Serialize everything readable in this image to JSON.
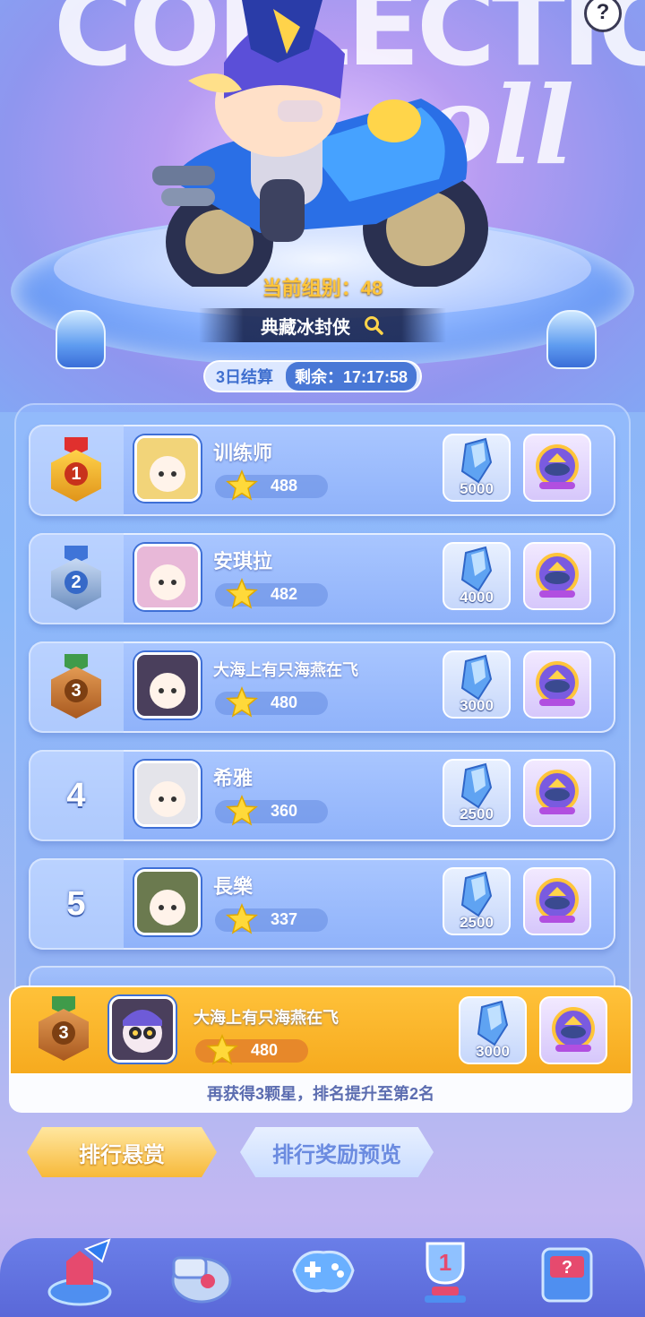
{
  "header": {
    "banner_text": "COLLECTION",
    "banner_text2": "oll",
    "help": "?",
    "group_label": "当前组别：48",
    "character_name": "典藏冰封侠",
    "settle_period": "3日结算",
    "remaining": "剩余：17:17:58"
  },
  "ranking": [
    {
      "rank": "1",
      "name": "训练师",
      "score": "488",
      "reward_amount": "5000",
      "medal": "gold"
    },
    {
      "rank": "2",
      "name": "安琪拉",
      "score": "482",
      "reward_amount": "4000",
      "medal": "silver"
    },
    {
      "rank": "3",
      "name": "大海上有只海燕在飞",
      "score": "480",
      "reward_amount": "3000",
      "medal": "bronze"
    },
    {
      "rank": "4",
      "name": "希雅",
      "score": "360",
      "reward_amount": "2500",
      "medal": ""
    },
    {
      "rank": "5",
      "name": "長樂",
      "score": "337",
      "reward_amount": "2500",
      "medal": ""
    }
  ],
  "my_rank": {
    "rank": "3",
    "name": "大海上有只海燕在飞",
    "score": "480",
    "reward_amount": "3000",
    "hint": "再获得3颗星，排名提升至第2名"
  },
  "tabs": {
    "bounty": "排行悬赏",
    "preview": "排行奖励预览"
  },
  "colors": {
    "gold": "#f2b41d",
    "silver": "#9fb6d8",
    "bronze": "#c77a36",
    "accent_blue": "#4978d6",
    "my_rank_bg": "#ffc23a"
  },
  "icons": {
    "reward_1": "crystal-icon",
    "reward_2": "car-badge-icon",
    "nav": [
      "home-icon",
      "whistle-icon",
      "gamepad-icon",
      "trophy-icon",
      "mystery-box-icon"
    ]
  }
}
